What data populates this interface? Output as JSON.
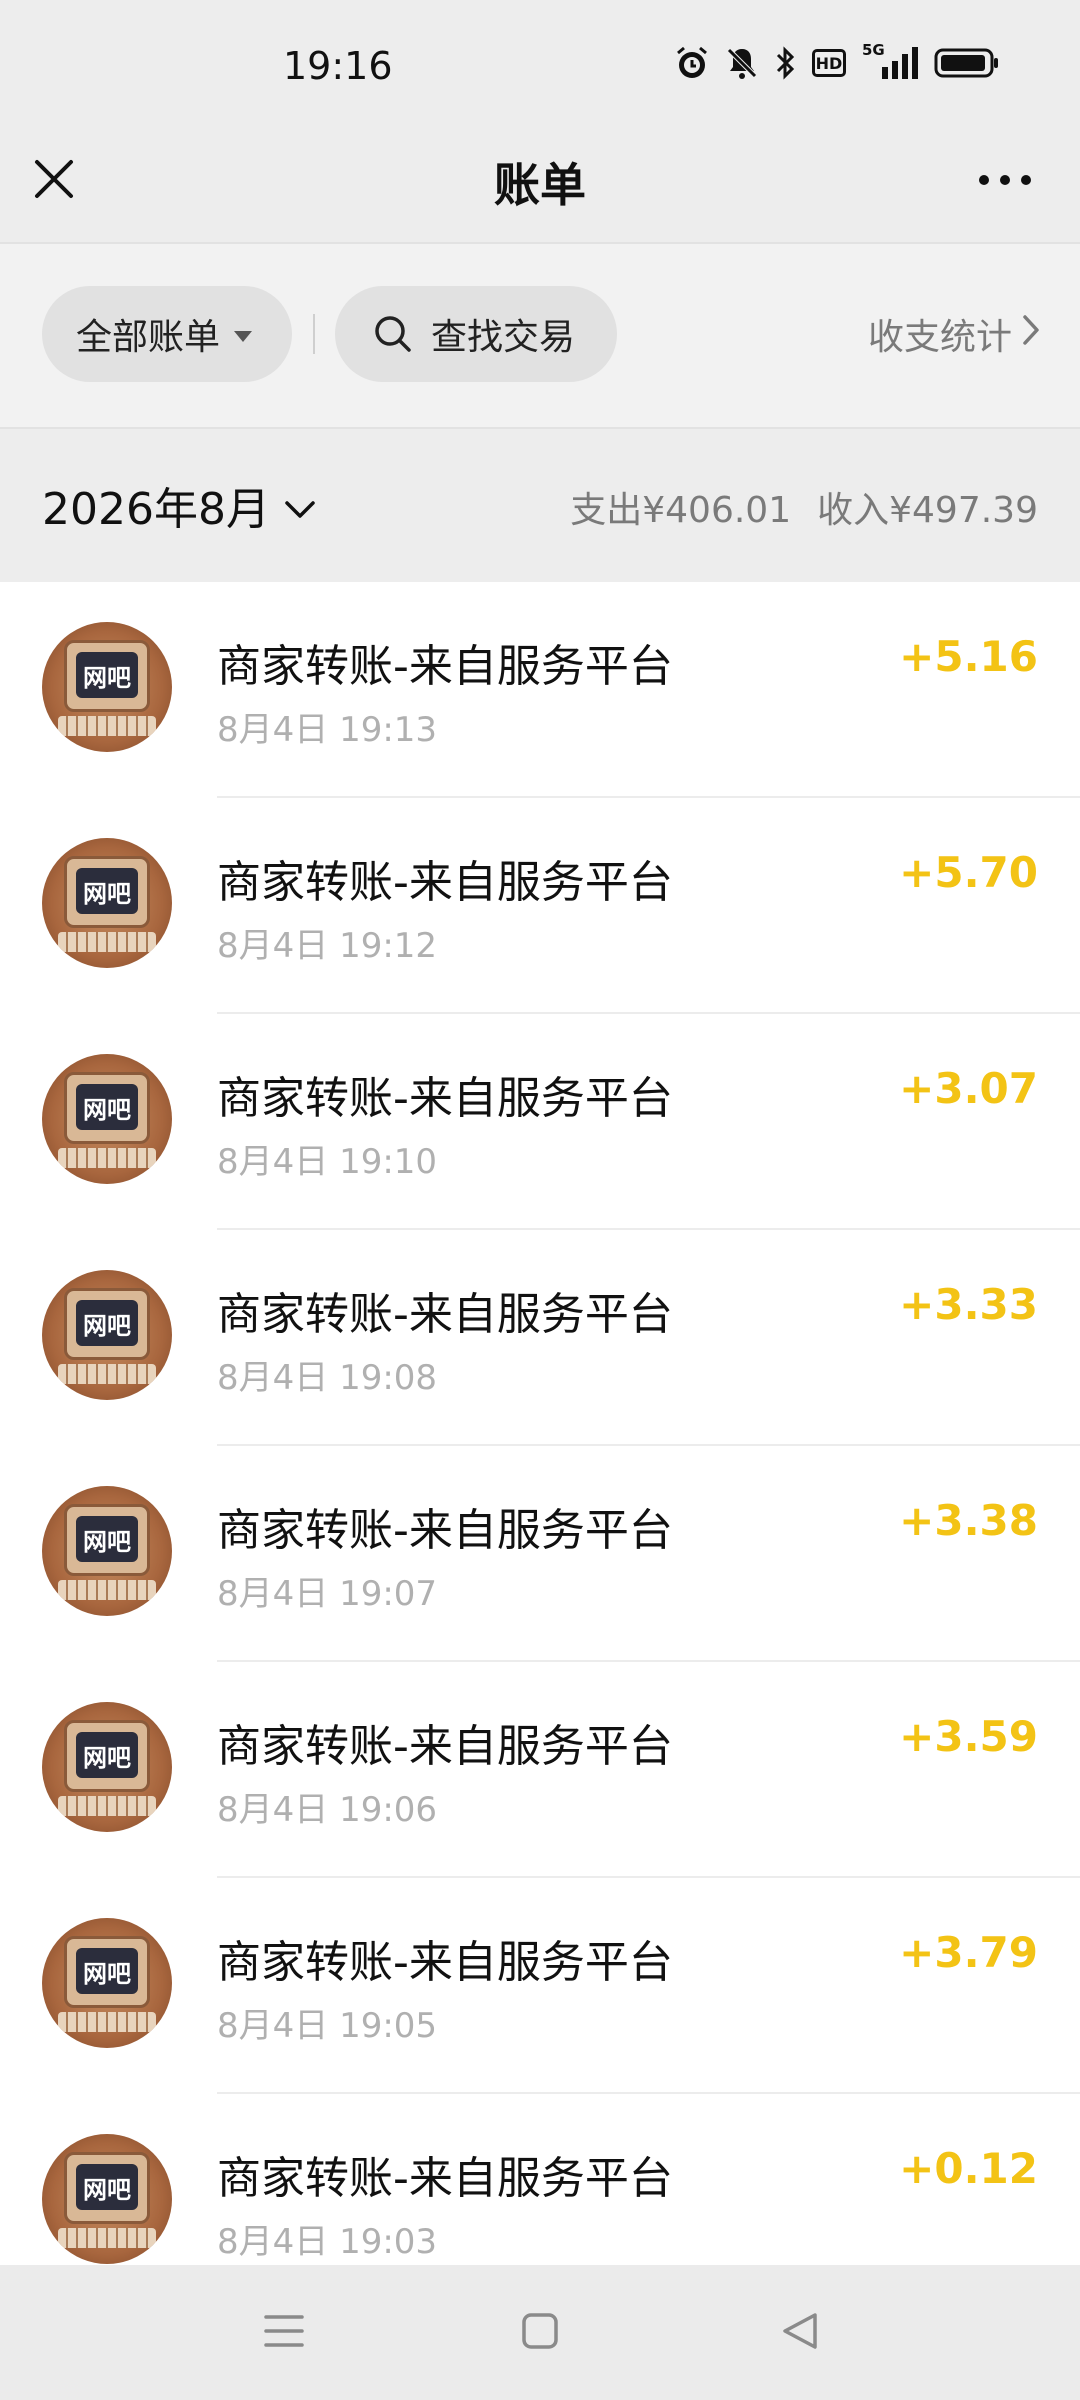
{
  "status_bar": {
    "time": "19:16",
    "icons": [
      "alarm-icon",
      "mute-icon",
      "bluetooth-icon",
      "hd-icon",
      "5g-signal-icon",
      "battery-icon"
    ],
    "network_label": "5G",
    "hd_label": "HD"
  },
  "header": {
    "title": "账单"
  },
  "filter": {
    "all_bills_label": "全部账单",
    "search_label": "查找交易",
    "stats_label": "收支统计"
  },
  "month": {
    "label": "2026年8月",
    "expense": "支出¥406.01",
    "income": "收入¥497.39"
  },
  "transactions": [
    {
      "avatar_text": "网吧",
      "title": "商家转账-来自服务平台",
      "time": "8月4日 19:13",
      "amount": "+5.16"
    },
    {
      "avatar_text": "网吧",
      "title": "商家转账-来自服务平台",
      "time": "8月4日 19:12",
      "amount": "+5.70"
    },
    {
      "avatar_text": "网吧",
      "title": "商家转账-来自服务平台",
      "time": "8月4日 19:10",
      "amount": "+3.07"
    },
    {
      "avatar_text": "网吧",
      "title": "商家转账-来自服务平台",
      "time": "8月4日 19:08",
      "amount": "+3.33"
    },
    {
      "avatar_text": "网吧",
      "title": "商家转账-来自服务平台",
      "time": "8月4日 19:07",
      "amount": "+3.38"
    },
    {
      "avatar_text": "网吧",
      "title": "商家转账-来自服务平台",
      "time": "8月4日 19:06",
      "amount": "+3.59"
    },
    {
      "avatar_text": "网吧",
      "title": "商家转账-来自服务平台",
      "time": "8月4日 19:05",
      "amount": "+3.79"
    },
    {
      "avatar_text": "网吧",
      "title": "商家转账-来自服务平台",
      "time": "8月4日 19:03",
      "amount": "+0.12"
    }
  ],
  "colors": {
    "income_amount": "#f3c315",
    "background": "#ededed",
    "list_background": "#ffffff"
  },
  "nav": {
    "icons": [
      "menu-icon",
      "home-icon",
      "back-icon"
    ]
  }
}
